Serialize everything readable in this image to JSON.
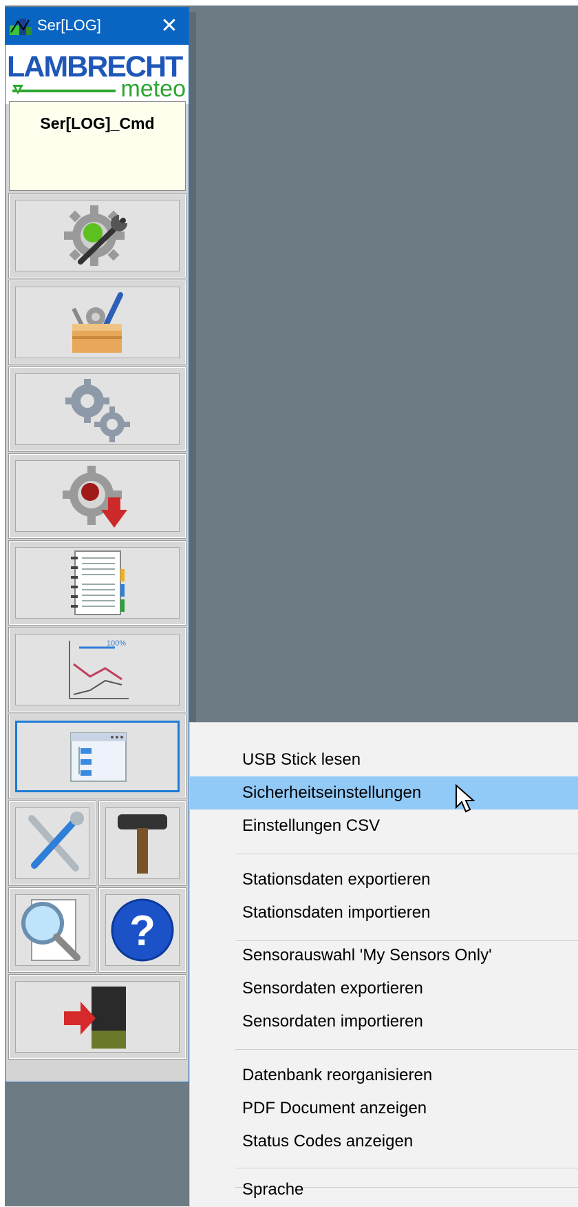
{
  "window": {
    "title": "Ser[LOG]",
    "close_glyph": "✕",
    "logo_main": "LAMBRECHT",
    "logo_sub": "meteo",
    "command_label": "Ser[LOG]_Cmd"
  },
  "toolbar": {
    "buttons": [
      {
        "name": "settings-wrench-gear-icon",
        "selected": false
      },
      {
        "name": "toolbox-icon",
        "selected": false
      },
      {
        "name": "gears-icon",
        "selected": false
      },
      {
        "name": "gear-record-download-icon",
        "selected": false
      },
      {
        "name": "notebook-icon",
        "selected": false
      },
      {
        "name": "line-chart-icon",
        "selected": false
      },
      {
        "name": "window-list-icon",
        "selected": true
      },
      {
        "name": "tools-icon",
        "selected": false
      },
      {
        "name": "hammer-icon",
        "selected": false
      },
      {
        "name": "magnifier-document-icon",
        "selected": false
      },
      {
        "name": "help-icon",
        "selected": false
      },
      {
        "name": "exit-door-icon",
        "selected": false
      }
    ],
    "chart_label": "100%"
  },
  "context_menu": {
    "items": [
      "USB Stick lesen",
      "Sicherheitseinstellungen",
      "Einstellungen CSV",
      "Stationsdaten exportieren",
      "Stationsdaten importieren",
      "Sensorauswahl 'My Sensors Only'",
      "Sensordaten exportieren",
      "Sensordaten importieren",
      "Datenbank reorganisieren",
      "PDF Document anzeigen",
      "Status Codes anzeigen",
      "Sprache"
    ],
    "hovered_item": "Sicherheitseinstellungen"
  },
  "colors": {
    "titlebar": "#0a64c2",
    "desktop": "#6d7b84",
    "menu_hover": "#91c9f7",
    "logo_blue": "#1e57b8",
    "logo_green": "#2ea62e"
  }
}
